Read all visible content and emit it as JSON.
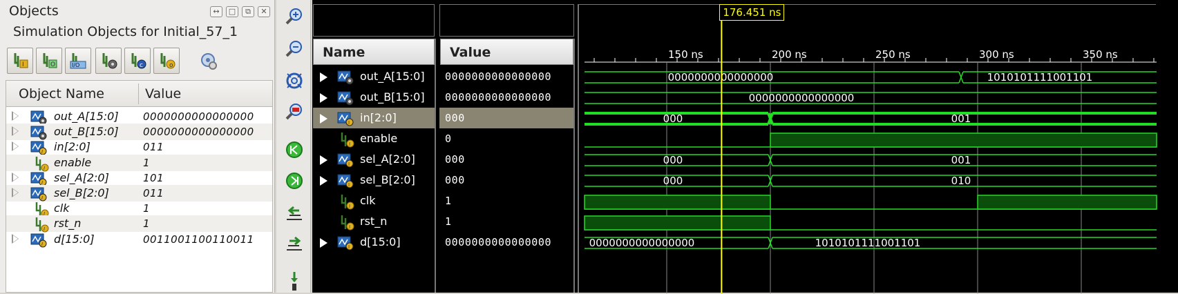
{
  "objects_panel": {
    "title": "Objects",
    "subtitle": "Simulation Objects for Initial_57_1",
    "columns": [
      "Object Name",
      "Value"
    ],
    "rows": [
      {
        "name": "out_A[15:0]",
        "value": "0000000000000000",
        "expandable": true,
        "icon": "bus-output-icon"
      },
      {
        "name": "out_B[15:0]",
        "value": "0000000000000000",
        "expandable": true,
        "icon": "bus-output-icon"
      },
      {
        "name": "in[2:0]",
        "value": "011",
        "expandable": true,
        "icon": "bus-input-icon"
      },
      {
        "name": "enable",
        "value": "1",
        "expandable": false,
        "icon": "signal-input-icon"
      },
      {
        "name": "sel_A[2:0]",
        "value": "101",
        "expandable": true,
        "icon": "bus-input-icon"
      },
      {
        "name": "sel_B[2:0]",
        "value": "011",
        "expandable": true,
        "icon": "bus-input-icon"
      },
      {
        "name": "clk",
        "value": "1",
        "expandable": false,
        "icon": "signal-input-icon"
      },
      {
        "name": "rst_n",
        "value": "1",
        "expandable": false,
        "icon": "signal-input-icon"
      },
      {
        "name": "d[15:0]",
        "value": "0011001100110011",
        "expandable": true,
        "icon": "bus-input-icon"
      }
    ]
  },
  "wave_window": {
    "cursor_time": "176.451 ns",
    "name_header": "Name",
    "value_header": "Value",
    "tick_labels": [
      "150 ns",
      "200 ns",
      "250 ns",
      "300 ns",
      "350 ns"
    ],
    "rows": [
      {
        "name": "out_A[15:0]",
        "value": "0000000000000000",
        "expandable": true,
        "icon": "bus-output-icon",
        "segments": [
          "0000000000000000",
          "1010101111001101"
        ]
      },
      {
        "name": "out_B[15:0]",
        "value": "0000000000000000",
        "expandable": true,
        "icon": "bus-output-icon",
        "segments": [
          "0000000000000000"
        ]
      },
      {
        "name": "in[2:0]",
        "value": "000",
        "expandable": true,
        "icon": "bus-input-icon",
        "selected": true,
        "segments": [
          "000",
          "001"
        ]
      },
      {
        "name": "enable",
        "value": "0",
        "expandable": false,
        "icon": "signal-input-icon"
      },
      {
        "name": "sel_A[2:0]",
        "value": "000",
        "expandable": true,
        "icon": "bus-input-icon",
        "segments": [
          "000",
          "001"
        ]
      },
      {
        "name": "sel_B[2:0]",
        "value": "000",
        "expandable": true,
        "icon": "bus-input-icon",
        "segments": [
          "000",
          "010"
        ]
      },
      {
        "name": "clk",
        "value": "1",
        "expandable": false,
        "icon": "signal-input-icon"
      },
      {
        "name": "rst_n",
        "value": "1",
        "expandable": false,
        "icon": "signal-input-icon"
      },
      {
        "name": "d[15:0]",
        "value": "0000000000000000",
        "expandable": true,
        "icon": "bus-input-icon",
        "segments": [
          "0000000000000000",
          "1010101111001101"
        ]
      }
    ]
  },
  "colors": {
    "wave_green": "#22dd22",
    "wave_fill": "#0b4d0b",
    "cursor": "#ffff00",
    "selected_row": "#8a8572"
  }
}
